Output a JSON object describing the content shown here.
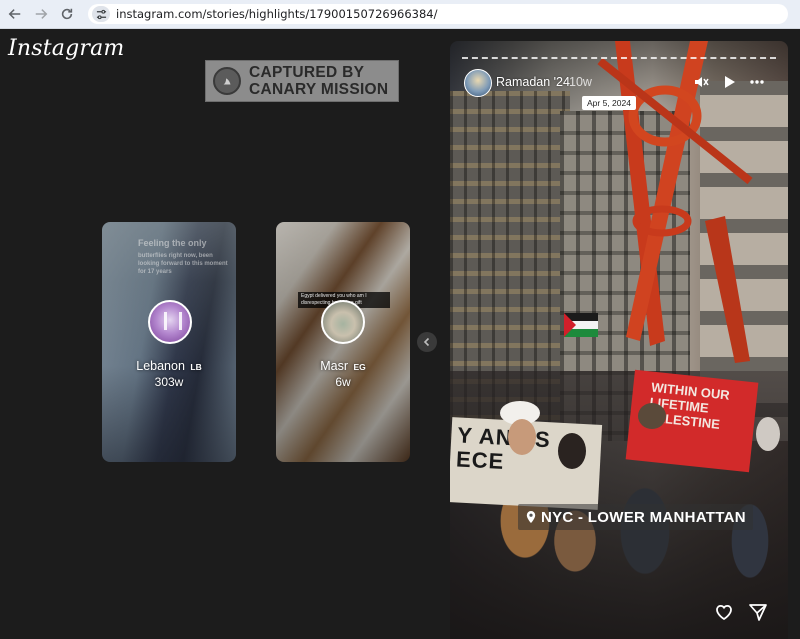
{
  "browser": {
    "url": "instagram.com/stories/highlights/17900150726966384/"
  },
  "app": {
    "logo_text": "Instagram"
  },
  "watermark": {
    "line1": "CAPTURED BY",
    "line2": "CANARY MISSION"
  },
  "highlights": [
    {
      "title": "Lebanon",
      "flag_code": "LB",
      "age": "303w",
      "faded_caption": "Feeling the only",
      "faded_caption_small": "butterflies right now, been looking forward to this moment for 17 years"
    },
    {
      "title": "Masr",
      "flag_code": "EG",
      "age": "6w",
      "caption_note": "Egypt delivered you who am I disrespecting her? It's a gift"
    }
  ],
  "story": {
    "username": "Ramadan '24",
    "age": "10w",
    "date_tooltip": "Apr 5, 2024",
    "location": "NYC - LOWER MANHATTAN",
    "banner_left_text": "Y ANY S\nECE",
    "banner_red_text": "WITHIN OUR LIFETIME PALESTINE"
  },
  "icons": {
    "back": "arrow-left-icon",
    "forward": "arrow-right-icon",
    "reload": "reload-icon",
    "site_info": "tune-icon",
    "mute": "speaker-muted-icon",
    "play": "play-icon",
    "more": "more-horizontal-icon",
    "like": "heart-icon",
    "share": "send-icon",
    "location": "location-pin-icon",
    "prev": "chevron-left-icon"
  }
}
